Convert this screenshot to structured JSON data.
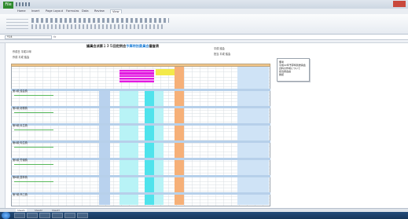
{
  "app": {
    "app_button": "File",
    "window_title": "",
    "tabs": [
      "File",
      "Home",
      "Insert",
      "Page Layout",
      "Formulas",
      "Data",
      "Review",
      "View"
    ],
    "active_tab_index": 0
  },
  "formula_bar": {
    "name_box": "Y14",
    "fx_label": "fx"
  },
  "document": {
    "title_pre": "議員会派第１３５回定例会",
    "title_highlight": "予算特別委員会",
    "title_post": "審査表",
    "meta_left_1": "作成日 平成22年",
    "meta_left_2": "作成 平成 議会",
    "meta_right_1": "平成 議会",
    "meta_right_2": "担当 平成 議会"
  },
  "note_box": {
    "title": "備考",
    "lines": [
      "平成22年予算特別委員会",
      "資料の作成について",
      "担当者会議",
      "確認"
    ]
  },
  "sections": [
    "第1款 議会費",
    "第2款 総務費",
    "第3款 民生費",
    "第4款 衛生費",
    "第5款 労働費",
    "第6款 農林費",
    "第7款 商工費"
  ],
  "sheet_tabs": [
    "Sheet1",
    "Sheet2",
    "Sheet3"
  ],
  "taskbar": {
    "tray_time": ""
  },
  "colors": {
    "magenta": "#e21be0",
    "cyan": "#4fe3ec",
    "orange": "#f6b078",
    "highlight_blue": "#1f7fd6"
  }
}
